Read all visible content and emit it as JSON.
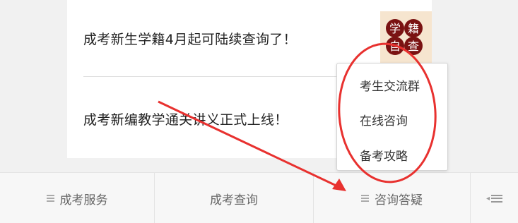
{
  "news": {
    "items": [
      {
        "title": "成考新生学籍4月起可陆续查询了！"
      },
      {
        "title": "成考新编教学通关讲义正式上线！"
      }
    ],
    "thumbnail": {
      "chars": [
        "学",
        "籍",
        "自",
        "查"
      ],
      "badge_color": "#7a1212",
      "background_color": "#f6e5cf"
    }
  },
  "popup_menu": {
    "items": [
      {
        "label": "考生交流群"
      },
      {
        "label": "在线咨询"
      },
      {
        "label": "备考攻略"
      }
    ]
  },
  "bottom_nav": {
    "tabs": [
      {
        "label": "成考服务",
        "icon": "menu-icon"
      },
      {
        "label": "成考查询"
      },
      {
        "label": "咨询答疑",
        "icon": "menu-icon"
      }
    ],
    "expand_icon": "expand-menu-icon"
  },
  "annotation": {
    "color": "#e8312f",
    "shapes": [
      "highlight-ellipse",
      "pointer-arrow"
    ]
  }
}
